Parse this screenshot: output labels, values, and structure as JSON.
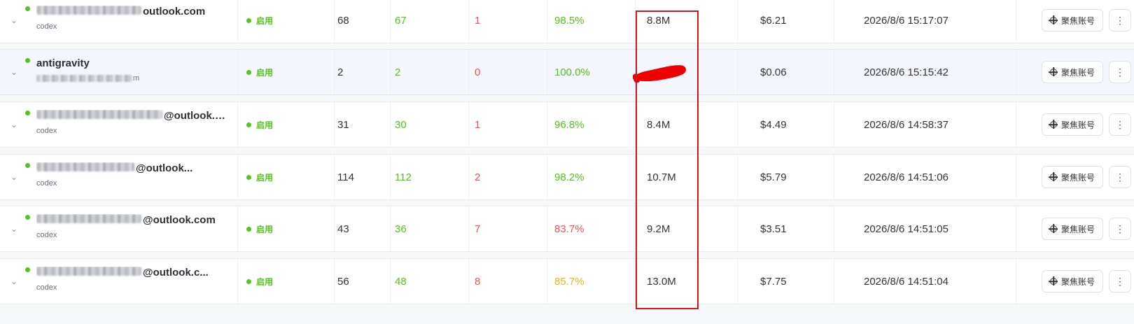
{
  "icons": {
    "expand": "chevron-down-icon",
    "focus": "crosshair-icon",
    "more": "more-vertical-icon"
  },
  "colors": {
    "success": "#52c41a",
    "fail": "#ff4d4f",
    "warning": "#faad14",
    "annotation": "#cc1818",
    "highlight_row": "#f4f7fd"
  },
  "glyphs": {
    "chevron": "⌄",
    "more": "⋮"
  },
  "rows": [
    {
      "account_visible": "outlook.com",
      "account_redacted": true,
      "sub": "codex",
      "sub_redacted": false,
      "status": "启用",
      "requests": "68",
      "success": "67",
      "fail": "1",
      "rate": "98.5%",
      "rate_level": "green",
      "tokens": "8.8M",
      "tokens_redacted": false,
      "cost": "$6.21",
      "time": "2026/8/6 15:17:07",
      "focus_label": "聚焦账号",
      "highlight": false
    },
    {
      "account_visible": "antigravity",
      "account_redacted": false,
      "sub": "m",
      "sub_redacted": true,
      "status": "启用",
      "requests": "2",
      "success": "2",
      "fail": "0",
      "rate": "100.0%",
      "rate_level": "green",
      "tokens": "",
      "tokens_redacted": true,
      "cost": "$0.06",
      "time": "2026/8/6 15:15:42",
      "focus_label": "聚焦账号",
      "highlight": true
    },
    {
      "account_visible": "@outlook.com",
      "account_redacted": true,
      "sub": "codex",
      "sub_redacted": false,
      "status": "启用",
      "requests": "31",
      "success": "30",
      "fail": "1",
      "rate": "96.8%",
      "rate_level": "green",
      "tokens": "8.4M",
      "tokens_redacted": false,
      "cost": "$4.49",
      "time": "2026/8/6 14:58:37",
      "focus_label": "聚焦账号",
      "highlight": false
    },
    {
      "account_visible": "@outlook...",
      "account_redacted": true,
      "sub": "codex",
      "sub_redacted": false,
      "status": "启用",
      "requests": "114",
      "success": "112",
      "fail": "2",
      "rate": "98.2%",
      "rate_level": "green",
      "tokens": "10.7M",
      "tokens_redacted": false,
      "cost": "$5.79",
      "time": "2026/8/6 14:51:06",
      "focus_label": "聚焦账号",
      "highlight": false
    },
    {
      "account_visible": "@outlook.com",
      "account_redacted": true,
      "sub": "codex",
      "sub_redacted": false,
      "status": "启用",
      "requests": "43",
      "success": "36",
      "fail": "7",
      "rate": "83.7%",
      "rate_level": "red",
      "tokens": "9.2M",
      "tokens_redacted": false,
      "cost": "$3.51",
      "time": "2026/8/6 14:51:05",
      "focus_label": "聚焦账号",
      "highlight": false
    },
    {
      "account_visible": "@outlook.c...",
      "account_redacted": true,
      "sub": "codex",
      "sub_redacted": false,
      "status": "启用",
      "requests": "56",
      "success": "48",
      "fail": "8",
      "rate": "85.7%",
      "rate_level": "orange",
      "tokens": "13.0M",
      "tokens_redacted": false,
      "cost": "$7.75",
      "time": "2026/8/6 14:51:04",
      "focus_label": "聚焦账号",
      "highlight": false
    }
  ]
}
